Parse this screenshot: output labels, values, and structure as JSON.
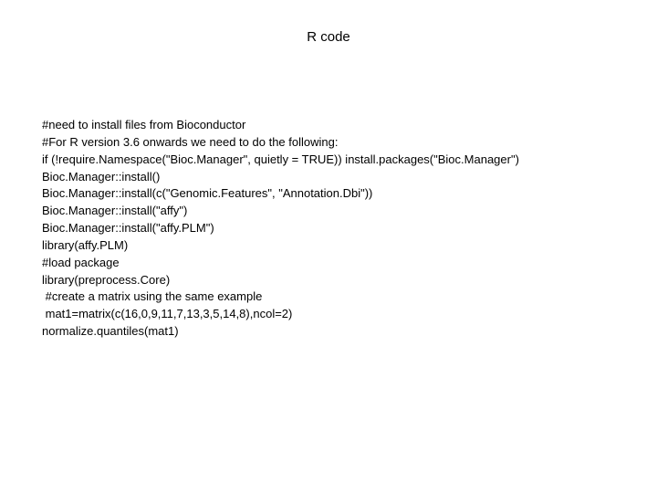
{
  "title": "R code",
  "code": {
    "lines": [
      "#need to install files from Bioconductor",
      "#For R version 3.6 onwards we need to do the following:",
      "if (!require.Namespace(\"Bioc.Manager\", quietly = TRUE)) install.packages(\"Bioc.Manager\")",
      "Bioc.Manager::install()",
      "Bioc.Manager::install(c(\"Genomic.Features\", \"Annotation.Dbi\"))",
      "Bioc.Manager::install(\"affy\")",
      "Bioc.Manager::install(\"affy.PLM\")",
      "library(affy.PLM)",
      "#load package",
      "library(preprocess.Core)",
      " #create a matrix using the same example",
      " mat1=matrix(c(16,0,9,11,7,13,3,5,14,8),ncol=2)",
      "normalize.quantiles(mat1)"
    ]
  }
}
